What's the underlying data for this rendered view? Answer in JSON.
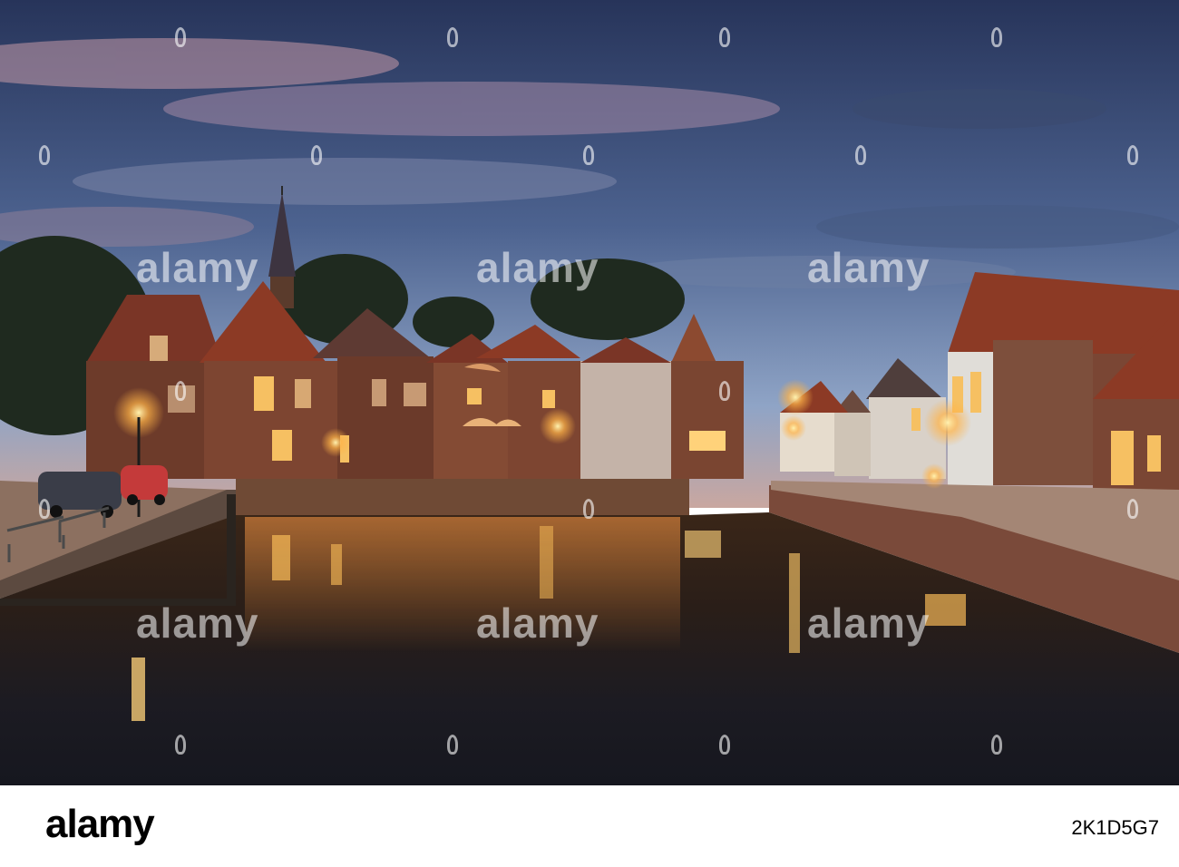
{
  "watermark": {
    "text": "alamy",
    "color": "#ffffff"
  },
  "footer": {
    "logo": "alamy",
    "image_id": "2K1D5G7"
  },
  "scene": {
    "sky_top": "#2f3f66",
    "sky_bottom": "#c9a7a0",
    "water": "#1a1a22",
    "light_color": "#ffb347",
    "brick": "#7a4630",
    "roof": "#8c3a25"
  }
}
